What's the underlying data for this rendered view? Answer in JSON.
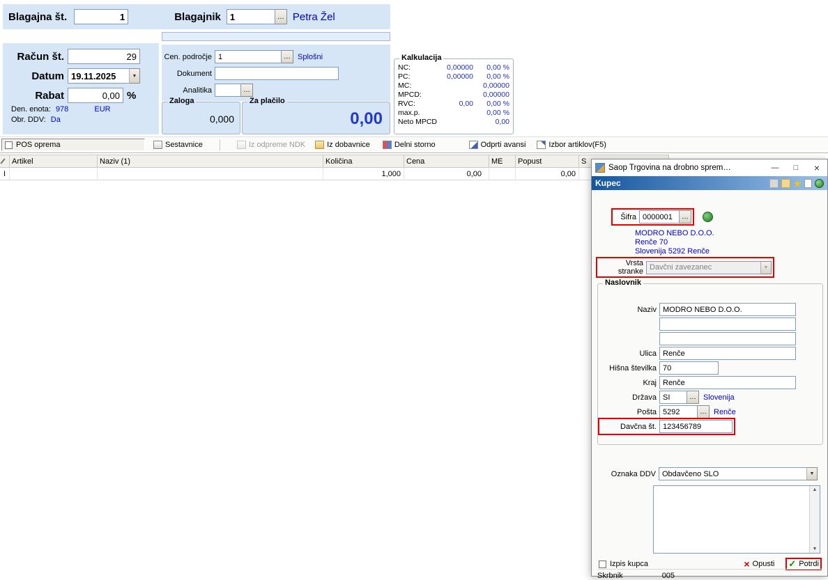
{
  "icons": {
    "lookup": "…",
    "dropdown": "▼",
    "minimize": "—",
    "maximize": "□",
    "close": "×",
    "check": "✓",
    "cross": "×",
    "up": "▲",
    "down": "▼",
    "star": "★"
  },
  "pos": {
    "blagajna_label": "Blagajna št.",
    "blagajna_value": "1",
    "blagajnik_label": "Blagajnik",
    "blagajnik_value": "1",
    "blagajnik_name": "Petra Žel",
    "racun_label": "Račun št.",
    "racun_value": "29",
    "datum_label": "Datum",
    "datum_value": "19.11.2025",
    "rabat_label": "Rabat",
    "rabat_value": "0,00",
    "rabat_unit": "%",
    "den_enota_label": "Den. enota:",
    "den_enota_code": "978",
    "den_enota_currency": "EUR",
    "obr_ddv_label": "Obr. DDV:",
    "obr_ddv_value": "Da",
    "cen_podrocje_label": "Cen. področje",
    "cen_podrocje_value": "1",
    "cen_podrocje_name": "Splošni",
    "dokument_label": "Dokument",
    "dokument_value": "",
    "analitika_label": "Analitika",
    "analitika_value": "",
    "zaloga_label": "Zaloga",
    "zaloga_value": "0,000",
    "za_placilo_label": "Za plačilo",
    "za_placilo_value": "0,00"
  },
  "kalkulacija": {
    "title": "Kalkulacija",
    "rows": [
      {
        "label": "NC:",
        "v1": "0,00000",
        "v2": "0,00 %"
      },
      {
        "label": "PC:",
        "v1": "0,00000",
        "v2": "0,00 %"
      },
      {
        "label": "MC:",
        "v1": "",
        "v2": "0,00000"
      },
      {
        "label": "MPCD:",
        "v1": "",
        "v2": "0,00000"
      },
      {
        "label": "RVC:",
        "v1": "0,00",
        "v2": "0,00 %"
      },
      {
        "label": "max.p.",
        "v1": "",
        "v2": "0,00 %"
      },
      {
        "label": "Neto MPCD",
        "v1": "",
        "v2": "0,00"
      }
    ]
  },
  "toolbar": {
    "pos_oprema": "POS oprema",
    "sestavnice": "Sestavnice",
    "iz_odpreme": "Iz odpreme NDK",
    "iz_dobavnice": "Iz dobavnice",
    "delni_storno": "Delni storno",
    "odprti_avansi": "Odprti avansi",
    "izbor_artiklov": "Izbor artiklov(F5)"
  },
  "grid": {
    "columns": [
      "Artikel",
      "Naziv (1)",
      "Količina",
      "Cena",
      "ME",
      "Popust",
      "S"
    ],
    "row_indicator": "I",
    "row": {
      "kolicina": "1,000",
      "cena": "0,00",
      "popust": "0,00"
    }
  },
  "dialog": {
    "title": "Saop Trgovina na drobno sprem…",
    "header": "Kupec",
    "sifra_label": "Šifra",
    "sifra_value": "0000001",
    "customer_name": "MODRO NEBO D.O.O.",
    "customer_street": "Renče 70",
    "customer_city": "Slovenija 5292 Renče",
    "vrsta_label": "Vrsta stranke",
    "vrsta_value": "Davčni zavezanec",
    "naslovnik": {
      "title": "Naslovnik",
      "naziv_label": "Naziv",
      "naziv_value": "MODRO NEBO D.O.O.",
      "naziv_value2": "",
      "naziv_value3": "",
      "ulica_label": "Ulica",
      "ulica_value": "Renče",
      "hisna_label": "Hišna številka",
      "hisna_value": "70",
      "kraj_label": "Kraj",
      "kraj_value": "Renče",
      "drzava_label": "Država",
      "drzava_value": "SI",
      "drzava_name": "Slovenija",
      "posta_label": "Pošta",
      "posta_value": "5292",
      "posta_name": "Renče",
      "davcna_label": "Davčna št.",
      "davcna_value": "123456789"
    },
    "oznaka_label": "Oznaka DDV",
    "oznaka_value": "Obdavčeno SLO",
    "notes_value": "",
    "izpis_kupca": "Izpis kupca",
    "opusti": "Opusti",
    "potrdi": "Potrdi",
    "status_left": "Skrbnik",
    "status_right": "005"
  }
}
